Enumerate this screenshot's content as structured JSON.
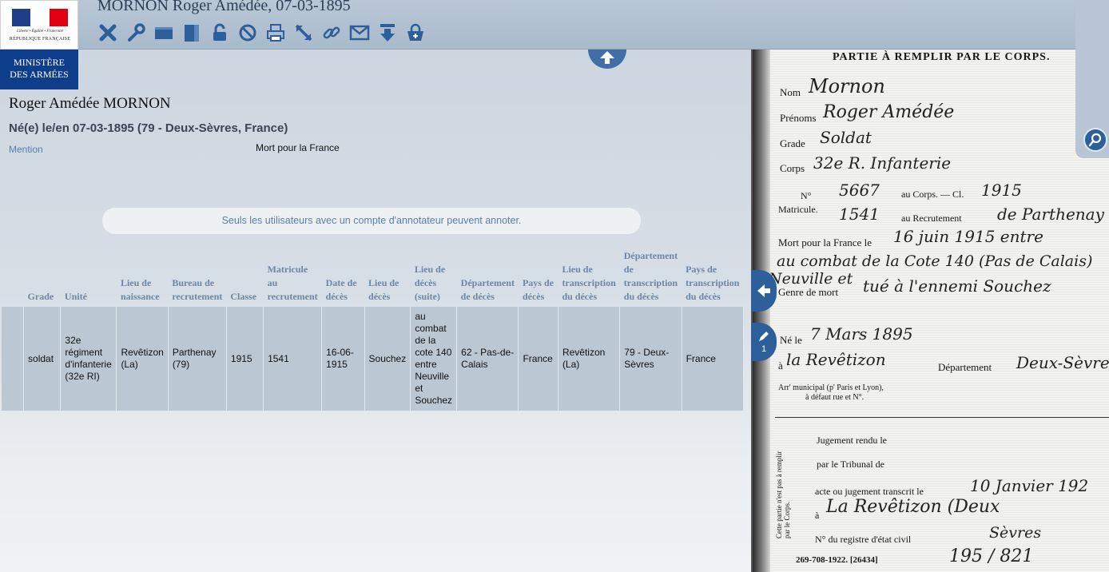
{
  "header": {
    "title": "MORNON Roger Amédée, 07-03-1895",
    "tools": [
      {
        "name": "close-icon"
      },
      {
        "name": "wrench-icon"
      },
      {
        "name": "horizontal-view-icon"
      },
      {
        "name": "vertical-view-icon"
      },
      {
        "name": "unlock-icon"
      },
      {
        "name": "forbidden-icon"
      },
      {
        "name": "print-icon"
      },
      {
        "name": "fullscreen-icon"
      },
      {
        "name": "link-icon"
      },
      {
        "name": "mail-icon"
      },
      {
        "name": "download-icon"
      },
      {
        "name": "basket-add-icon"
      }
    ],
    "colors": {
      "accent": "#2d5f9a",
      "bar": "#b0c0d0"
    }
  },
  "logo": {
    "motto": "Liberté • Égalité • Fraternité",
    "republic": "RÉPUBLIQUE FRANÇAISE",
    "ministry_line1": "MINISTÈRE",
    "ministry_line2": "DES ARMÉES"
  },
  "record": {
    "name": "Roger Amédée MORNON",
    "birth": "Né(e) le/en 07-03-1895 (79 - Deux-Sèvres, France)",
    "mention_label": "Mention",
    "mention_value": "Mort pour la France",
    "notice": "Seuls les utilisateurs avec un compte d'annotateur peuvent annoter."
  },
  "table": {
    "headers": [
      "",
      "Grade",
      "Unité",
      "Lieu de naissance",
      "Bureau de recrutement",
      "Classe",
      "Matricule au recrutement",
      "Date de décès",
      "Lieu de décès",
      "Lieu de décès (suite)",
      "Département de décès",
      "Pays de décès",
      "Lieu de transcription du décès",
      "Département de transcription du décès",
      "Pays de transcription du décès"
    ],
    "row": [
      "",
      "soldat",
      "32e régiment d'infanterie (32e RI)",
      "Revêtizon (La)",
      "Parthenay (79)",
      "1915",
      "1541",
      "16-06-1915",
      "Souchez",
      "au combat de la cote 140 entre Neuville et Souchez",
      "62 - Pas-de-Calais",
      "France",
      "Revêtizon (La)",
      "79 - Deux-Sèvres",
      "France"
    ]
  },
  "document": {
    "heading": "PARTIE À REMPLIR PAR LE CORPS.",
    "labels": {
      "nom": "Nom",
      "prenoms": "Prénoms",
      "grade": "Grade",
      "corps": "Corps",
      "no": "N°",
      "matricule": "Matricule.",
      "au_corps": "au Corps. — Cl.",
      "au_recrutement": "au Recrutement",
      "mort": "Mort pour la France le",
      "genre": "Genre de mort",
      "ne_le": "Né le",
      "a": "à",
      "departement": "Département",
      "arr": "Arr' municipal (p' Paris et Lyon),",
      "arr2": "à défaut rue et N°.",
      "jugement": "Jugement rendu le",
      "tribunal": "par le Tribunal de",
      "acte": "acte ou jugement transcrit le",
      "registre": "N° du registre d'état civil",
      "side_note": "Cette partie n'est pas à remplir par le Corps.",
      "footer": "269-708-1922. [26434]"
    },
    "handwriting": {
      "nom": "Mornon",
      "prenoms": "Roger Amédée",
      "grade": "Soldat",
      "corps": "32e R. Infanterie",
      "no_corps": "5667",
      "classe": "1915",
      "no_recrutement": "1541",
      "recrutement": "de Parthenay",
      "mort_date": "16 juin 1915 entre",
      "mort_lieu": "au combat de la Cote 140 (Pas de Calais)",
      "mort_lieu2": "Neuville et",
      "genre": "tué à l'ennemi Souchez",
      "ne_le": "7 Mars 1895",
      "ne_a": "la Revêtizon",
      "departement": "Deux-Sèvres",
      "transcrit": "10 Janvier 192",
      "transcrit_a": "La Revêtizon (Deux",
      "sevres": "Sèvres",
      "registre": "195 / 821"
    },
    "page_indicator": "1"
  }
}
